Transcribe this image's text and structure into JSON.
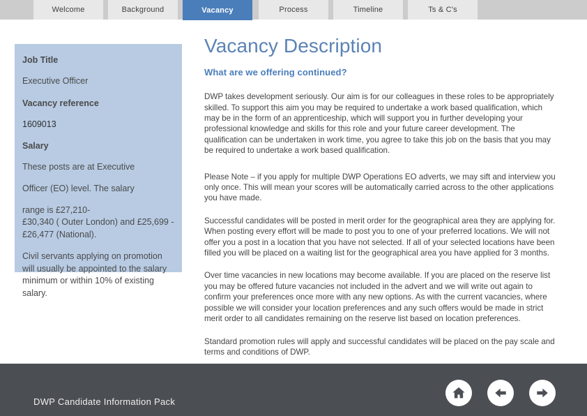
{
  "tabs": [
    {
      "label": "Welcome",
      "active": false
    },
    {
      "label": "Background",
      "active": false
    },
    {
      "label": "Vacancy",
      "active": true
    },
    {
      "label": "Process",
      "active": false
    },
    {
      "label": "Timeline",
      "active": false
    },
    {
      "label": "Ts & C's",
      "active": false
    }
  ],
  "sidebar": {
    "job_title_label": "Job Title",
    "job_title_value": "Executive Officer",
    "vacancy_ref_label": "Vacancy reference",
    "vacancy_ref_value": "1609013",
    "salary_label": "Salary",
    "salary_line_1": "These posts are at Executive",
    "salary_line_2": "Officer (EO) level. The salary",
    "salary_line_3": "range is £27,210-",
    "salary_line_4": "£30,340 ( Outer London) and £25,699 -",
    "salary_line_5": "£26,477 (National).",
    "promotion_note": "Civil servants applying on promotion will usually be appointed to the salary minimum or within 10% of existing salary."
  },
  "main": {
    "page_title": "Vacancy Description",
    "sub_title": "What are we offering continued?",
    "paragraphs": [
      "DWP takes development seriously. Our aim is for our colleagues in these roles to be appropriately skilled. To support this aim you may be required to undertake a work based qualification, which may be in the form of an apprenticeship, which will support you in further developing your professional knowledge and skills for this role and your future career development. The qualification can be undertaken in work time, you agree to take this job on the basis that you may be required to undertake a work based qualification.",
      "Please Note – if you apply for multiple DWP Operations EO adverts, we may sift and interview you only once. This will mean your scores will be automatically carried across to the other applications you have made.",
      "Successful candidates will be posted in merit order for the geographical area they are applying for. When posting every effort will be made to post you to one of your preferred locations. We will not offer you a post in a location that you have not selected. If all of your selected locations have been filled you will be placed on a waiting list for the geographical area you have applied for 3 months.",
      "Over time vacancies in new locations may become available. If you are placed on the reserve list you may be offered future vacancies not included in the advert and we will write out again to confirm your preferences once more with any new options. As with the current vacancies, where possible we will consider your location preferences and any such offers would be made in strict merit order to all candidates remaining on the reserve list based on location preferences.",
      "Standard promotion rules will apply and successful candidates will be placed on the pay scale and terms and conditions of DWP."
    ]
  },
  "footer": {
    "label": "DWP Candidate Information Pack",
    "buttons": [
      {
        "name": "home-icon",
        "title": "Home"
      },
      {
        "name": "arrow-left-icon",
        "title": "Previous"
      },
      {
        "name": "arrow-right-icon",
        "title": "Next"
      }
    ]
  },
  "colors": {
    "topbar": "#cccccc",
    "tab_inactive": "#e8e8e8",
    "tab_active": "#4a7ebb",
    "sidebar_bg": "#b8cbe3",
    "title_blue": "#5b83b5",
    "subtitle_blue": "#4a7ebb",
    "footer_bg": "#4b4e53",
    "body_text": "#444444"
  }
}
